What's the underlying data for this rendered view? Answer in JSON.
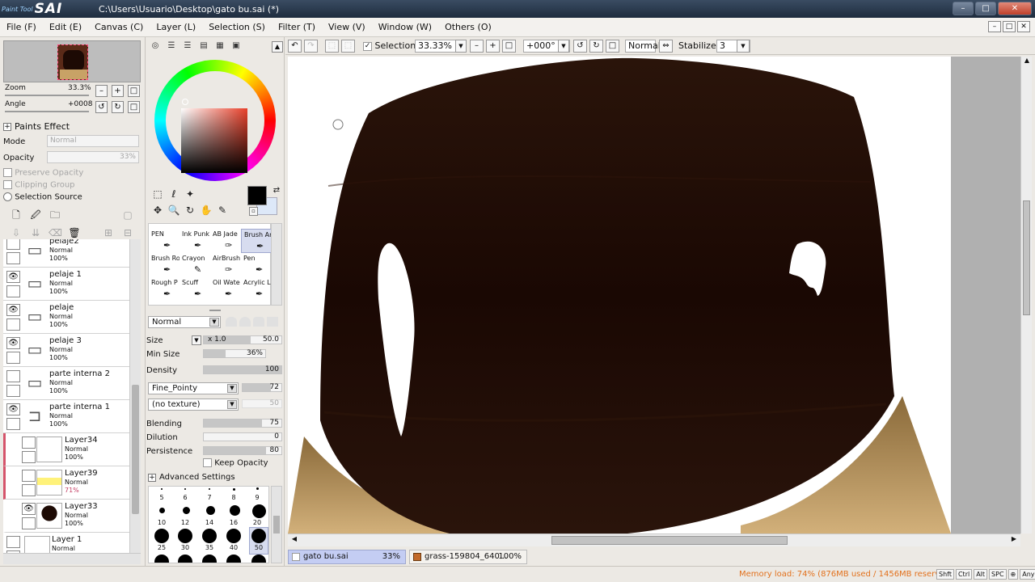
{
  "app": {
    "title": "C:\\Users\\Usuario\\Desktop\\gato bu.sai (*)",
    "logo_small": "Paint Tool",
    "logo_big": "SAI"
  },
  "window_controls": {
    "minimize": "–",
    "maximize": "□",
    "close": "✕"
  },
  "menu": {
    "items": [
      "File (F)",
      "Edit (E)",
      "Canvas (C)",
      "Layer (L)",
      "Selection (S)",
      "Filter (T)",
      "View (V)",
      "Window (W)",
      "Others (O)"
    ]
  },
  "navigator": {
    "zoom_label": "Zoom",
    "zoom_value": "33.3%",
    "angle_label": "Angle",
    "angle_value": "+0008"
  },
  "paints_effect": {
    "title": "Paints Effect",
    "mode_label": "Mode",
    "mode_value": "Normal",
    "opacity_label": "Opacity",
    "opacity_value": "33%",
    "preserve_opacity": "Preserve Opacity",
    "clipping_group": "Clipping Group",
    "selection_source": "Selection Source"
  },
  "layers": [
    {
      "name": "pelaje2",
      "mode": "Normal",
      "opacity": "100%",
      "type": "folder",
      "visible": false
    },
    {
      "name": "pelaje 1",
      "mode": "Normal",
      "opacity": "100%",
      "type": "folder",
      "visible": true
    },
    {
      "name": "pelaje",
      "mode": "Normal",
      "opacity": "100%",
      "type": "folder",
      "visible": true
    },
    {
      "name": "pelaje 3",
      "mode": "Normal",
      "opacity": "100%",
      "type": "folder",
      "visible": true
    },
    {
      "name": "parte interna 2",
      "mode": "Normal",
      "opacity": "100%",
      "type": "folder",
      "visible": false
    },
    {
      "name": "parte interna 1",
      "mode": "Normal",
      "opacity": "100%",
      "type": "folder-open",
      "visible": true
    },
    {
      "name": "Layer34",
      "mode": "Normal",
      "opacity": "100%",
      "type": "layer",
      "visible": false
    },
    {
      "name": "Layer39",
      "mode": "Normal",
      "opacity": "71%",
      "type": "layer",
      "visible": false
    },
    {
      "name": "Layer33",
      "mode": "Normal",
      "opacity": "100%",
      "type": "layer",
      "visible": true
    },
    {
      "name": "Layer 1",
      "mode": "Normal",
      "opacity": "",
      "type": "layer-root",
      "visible": false
    }
  ],
  "brushes": [
    {
      "label": "PEN"
    },
    {
      "label": "Ink Punk"
    },
    {
      "label": "AB Jade"
    },
    {
      "label": "Brush Ar"
    },
    {
      "label": "Brush Ro"
    },
    {
      "label": "Crayon"
    },
    {
      "label": "AirBrush"
    },
    {
      "label": "Pen"
    },
    {
      "label": "Rough P"
    },
    {
      "label": "Scuff"
    },
    {
      "label": "Oil Wate"
    },
    {
      "label": "Acrylic L"
    }
  ],
  "brush_settings": {
    "blend_mode": "Normal",
    "size_label": "Size",
    "size_multiplier": "x 1.0",
    "size_value": "50.0",
    "min_size_label": "Min Size",
    "min_size_value": "36%",
    "min_size_fraction": 0.36,
    "density_label": "Density",
    "density_value": "100",
    "shape": "Fine_Pointy",
    "shape_value": "72",
    "texture": "(no texture)",
    "texture_value": "50",
    "blending_label": "Blending",
    "blending_value": "75",
    "dilution_label": "Dilution",
    "dilution_value": "0",
    "persistence_label": "Persistence",
    "persistence_value": "80",
    "keep_opacity": "Keep Opacity",
    "advanced": "Advanced Settings"
  },
  "brush_sizes": [
    "5",
    "6",
    "7",
    "8",
    "9",
    "10",
    "12",
    "14",
    "16",
    "20",
    "25",
    "30",
    "35",
    "40",
    "50"
  ],
  "canvas_toolbar": {
    "selection_label": "Selection",
    "zoom": "33.33%",
    "angle": "+000°",
    "mode": "Normal",
    "stabilizer_label": "Stabilizer",
    "stabilizer_value": "3"
  },
  "doc_tabs": [
    {
      "name": "gato bu.sai",
      "zoom": "33%",
      "active": true
    },
    {
      "name": "grass-159804_640...",
      "zoom": "100%",
      "active": false
    }
  ],
  "status": {
    "memory": "Memory load: 74% (876MB used / 1456MB reserved)",
    "keys": [
      "Shft",
      "Ctrl",
      "Alt",
      "SPC",
      "⊕",
      "Any"
    ]
  },
  "colors": {
    "accent": "#c4cdf3",
    "memory_text": "#e2711d",
    "hair_dark": "#1d0a04",
    "hair_light": "#c8a266"
  }
}
